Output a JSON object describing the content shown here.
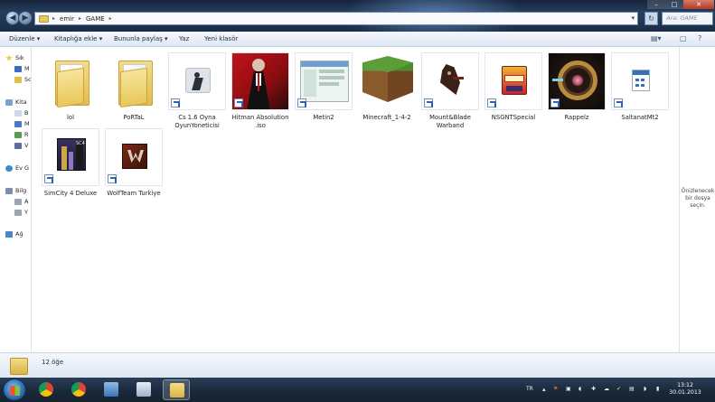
{
  "window": {
    "breadcrumb": [
      "emir",
      "GAME"
    ],
    "search_placeholder": "Ara: GAME",
    "controls": {
      "minimize": "–",
      "maximize": "□",
      "close": "✕"
    }
  },
  "toolbar": {
    "organize": "Düzenle ▾",
    "include_library": "Kitaplığa ekle ▾",
    "share_with": "Bununla paylaş ▾",
    "burn": "Yaz",
    "new_folder": "Yeni klasör"
  },
  "sidebar": {
    "items": [
      {
        "label": "Sık",
        "icon": "star-icon"
      },
      {
        "label": "M",
        "icon": "desktop-icon"
      },
      {
        "label": "Sc",
        "icon": "folder-icon"
      },
      {
        "label": "Kita",
        "icon": "library-icon"
      },
      {
        "label": "B",
        "icon": "document-icon"
      },
      {
        "label": "M",
        "icon": "music-icon"
      },
      {
        "label": "R",
        "icon": "picture-icon"
      },
      {
        "label": "V",
        "icon": "video-icon"
      },
      {
        "label": "Ev G",
        "icon": "homegroup-icon"
      },
      {
        "label": "Bilg",
        "icon": "computer-icon"
      },
      {
        "label": "A",
        "icon": "drive-icon"
      },
      {
        "label": "Y",
        "icon": "drive-icon"
      },
      {
        "label": "Ağ",
        "icon": "network-icon"
      }
    ]
  },
  "files": [
    {
      "name": "lol",
      "type": "folder"
    },
    {
      "name": "PoRTaL",
      "type": "folder"
    },
    {
      "name": "Cs 1.6 Oyna OyunYoneticisi",
      "type": "shortcut",
      "icon": "counter-strike-icon"
    },
    {
      "name": "Hitman Absolution .iso",
      "type": "shortcut",
      "icon": "hitman-icon"
    },
    {
      "name": "Metin2",
      "type": "shortcut",
      "icon": "metin2-icon"
    },
    {
      "name": "Minecraft_1-4-2",
      "type": "file",
      "icon": "minecraft-icon"
    },
    {
      "name": "Mount&Blade Warband",
      "type": "shortcut",
      "icon": "horse-icon"
    },
    {
      "name": "NSGNTSpecial",
      "type": "shortcut",
      "icon": "nsgnt-icon"
    },
    {
      "name": "Rappelz",
      "type": "shortcut",
      "icon": "rappelz-icon"
    },
    {
      "name": "SaltanatMt2",
      "type": "shortcut",
      "icon": "saltanat-icon"
    },
    {
      "name": "SimCity 4 Deluxe",
      "type": "shortcut",
      "icon": "simcity-icon"
    },
    {
      "name": "WolfTeam Turkiye",
      "type": "shortcut",
      "icon": "wolfteam-icon"
    }
  ],
  "preview": {
    "text": "Önizlenecek bir dosya seçin."
  },
  "details": {
    "count": "12 öğe"
  },
  "taskbar": {
    "language": "TR",
    "time": "13:12",
    "date": "30.01.2013",
    "apps": [
      "chrome-icon",
      "chrome-icon",
      "control-panel-icon",
      "media-icon",
      "explorer-icon"
    ]
  }
}
